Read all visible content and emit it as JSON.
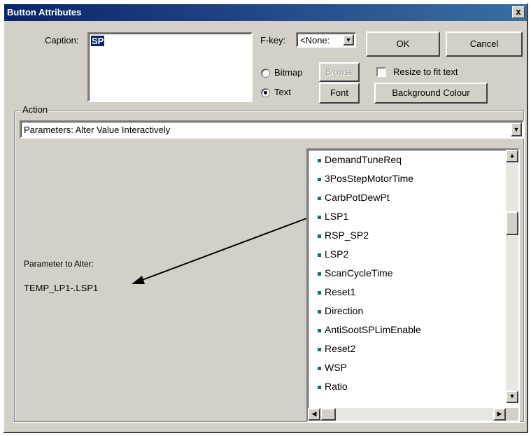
{
  "window": {
    "title": "Button Attributes",
    "close_label": "x"
  },
  "caption": {
    "label": "Caption:",
    "value": "SP"
  },
  "fkey": {
    "label": "F-key:",
    "value": "<None:"
  },
  "buttons": {
    "ok": "OK",
    "cancel": "Cancel",
    "browse": "Browse",
    "font": "Font",
    "background_colour": "Background Colour"
  },
  "type_options": {
    "bitmap": {
      "label": "Bitmap",
      "selected": false
    },
    "text": {
      "label": "Text",
      "selected": true
    }
  },
  "resize_checkbox": {
    "label": "Resize to fit text",
    "checked": false
  },
  "action": {
    "group_label": "Action",
    "selected": "Parameters: Alter Value Interactively"
  },
  "parameter": {
    "label": "Parameter to Alter:",
    "value": "TEMP_LP1-.LSP1"
  },
  "param_list": {
    "items": [
      "DemandTuneReq",
      "3PosStepMotorTime",
      "CarbPotDewPt",
      "LSP1",
      "RSP_SP2",
      "LSP2",
      "ScanCycleTime",
      "Reset1",
      "Direction",
      "AntiSootSPLimEnable",
      "Reset2",
      "WSP",
      "Ratio"
    ]
  },
  "colors": {
    "title_bar": "#0a246a",
    "face": "#d4d0c8",
    "bullet": "#1a6e6e",
    "selection": "#0a246a"
  }
}
